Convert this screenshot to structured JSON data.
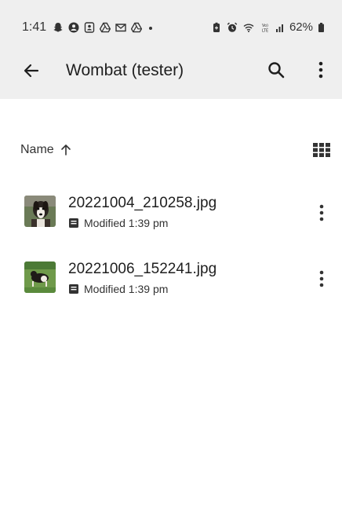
{
  "status_bar": {
    "time": "1:41",
    "battery": "62%"
  },
  "app_bar": {
    "title": "Wombat (tester)",
    "back_icon": "arrow-left-icon",
    "search_icon": "search-icon",
    "more_icon": "more-vertical-icon"
  },
  "sort": {
    "label": "Name",
    "direction_icon": "arrow-up-icon",
    "view_icon": "grid-view-icon"
  },
  "files": [
    {
      "name": "20221004_210258.jpg",
      "modified": "Modified 1:39 pm"
    },
    {
      "name": "20221006_152241.jpg",
      "modified": "Modified 1:39 pm"
    }
  ],
  "colors": {
    "bar_background": "#efefef",
    "text_primary": "#1f1f1f"
  }
}
